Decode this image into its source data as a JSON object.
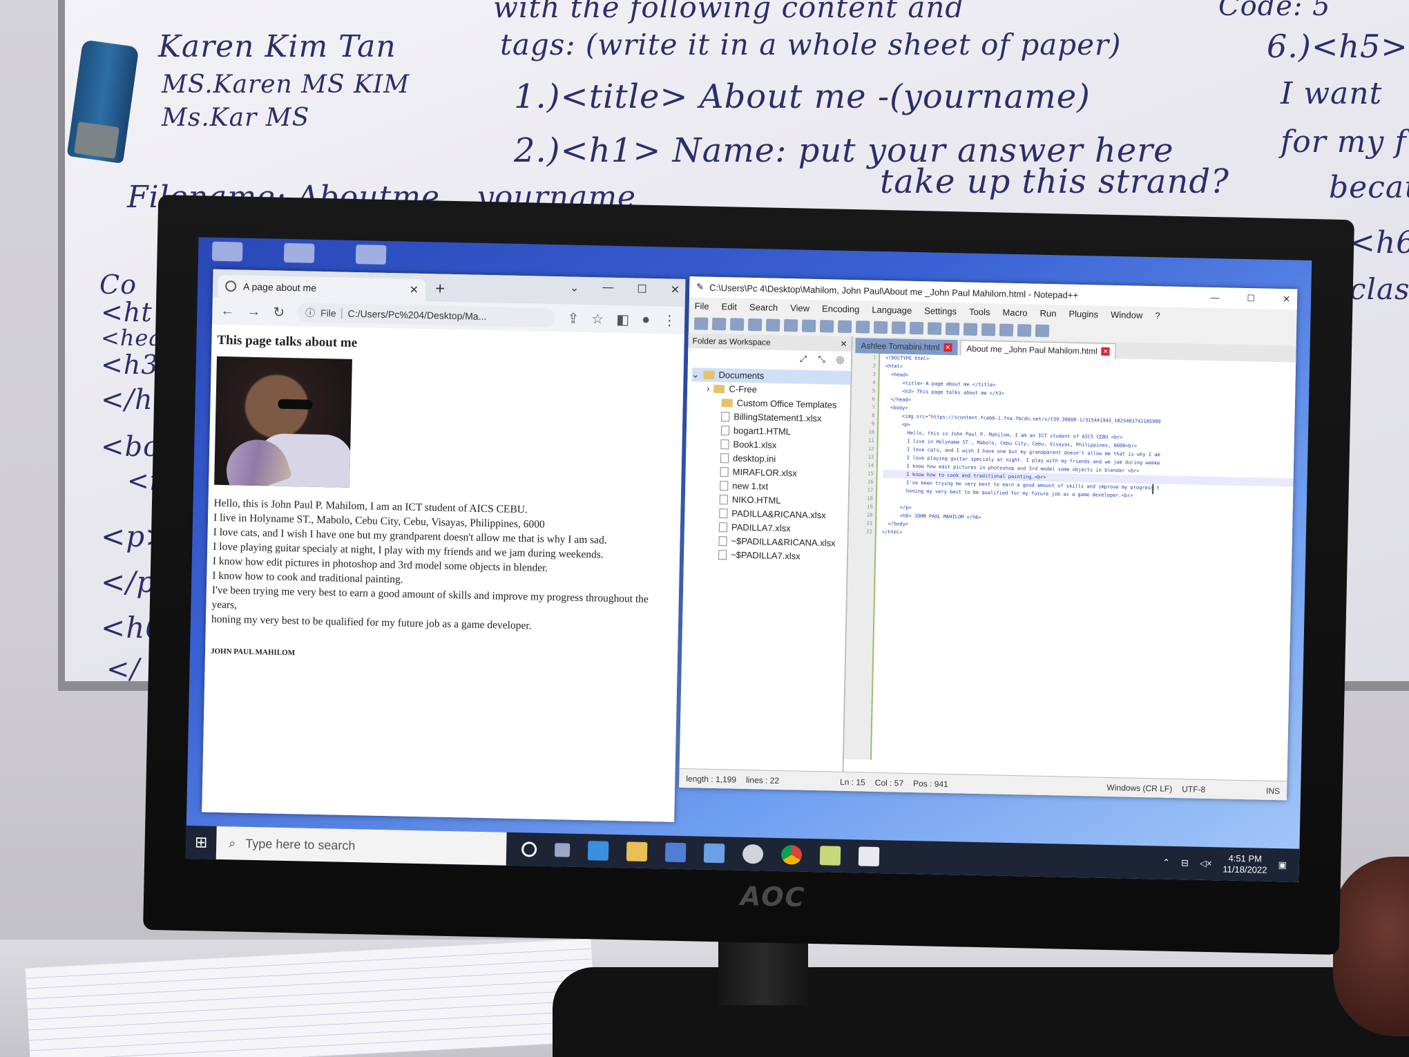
{
  "whiteboard": {
    "lines": [
      "Karen Kim Tan",
      "MS.Karen   MS KIM",
      "Ms.Kar      MS",
      "with the following content and",
      "tags: (write it in a whole sheet of paper)",
      "1.)<title> About me -(yourname)",
      "2.)<h1> Name: put your answer here",
      "Filename: Aboutme _ yourname",
      "take up this strand?",
      "6.)<h5>",
      "I want",
      "for my f",
      "becau",
      "<h6>",
      "class",
      "Code: 5"
    ],
    "left_tags": [
      "Co",
      "<ht",
      "<hea",
      "<h3",
      "</he",
      "<bod",
      "<i",
      "<p>",
      "</p",
      "<h6",
      "</"
    ]
  },
  "monitor": {
    "brand": "AOC"
  },
  "browser": {
    "tab_title": "A page about me",
    "address_chip": "File",
    "address": "C:/Users/Pc%204/Desktop/Ma...",
    "page": {
      "heading": "This page talks about me",
      "image_alt": "profile photo",
      "paragraph_lines": [
        "Hello, this is John Paul P. Mahilom, I am an ICT student of AICS CEBU.",
        "I live in Holyname ST., Mabolo, Cebu City, Cebu, Visayas, Philippines, 6000",
        "I love cats, and I wish I have one but my grandparent doesn't allow me that is why I am sad.",
        "I love playing guitar specialy at night, I play with my friends and we jam during weekends.",
        "I know how edit pictures in photoshop and 3rd model some objects in blender.",
        "I know how to cook and traditional painting.",
        "I've been trying me very best to earn a good amount of skills and improve my progress throughout the years,",
        "honing my very best to be qualified for my future job as a game developer."
      ],
      "h6": "JOHN PAUL MAHILOM"
    }
  },
  "notepad": {
    "title": "C:\\Users\\Pc 4\\Desktop\\Mahilom, John Paul\\About me _John Paul Mahilom.html - Notepad++",
    "menu": [
      "File",
      "Edit",
      "Search",
      "View",
      "Encoding",
      "Language",
      "Settings",
      "Tools",
      "Macro",
      "Run",
      "Plugins",
      "Window",
      "?"
    ],
    "sidebar_title": "Folder as Workspace",
    "tree": {
      "root": "Documents",
      "folders": [
        "C-Free",
        "Custom Office Templates"
      ],
      "files": [
        "BillingStatement1.xlsx",
        "bogart1.HTML",
        "Book1.xlsx",
        "desktop.ini",
        "MIRAFLOR.xlsx",
        "new 1.txt",
        "NIKO.HTML",
        "PADILLA&RICANA.xlsx",
        "PADILLA7.xlsx",
        "~$PADILLA&RICANA.xlsx",
        "~$PADILLA7.xlsx"
      ]
    },
    "tabs": [
      "Ashlee Tomabini.html",
      "About me _John Paul Mahilom.html"
    ],
    "code_lines": [
      "<!DOCTYPE html>",
      "<html>",
      "  <head>",
      "      <title> A page about me </title>",
      "      <h3> This page talks about me </h3>",
      "  </head>",
      "  <body>",
      "      <img src=\"https://scontent.fceb6-1.fna.fbcdn.net/v/t39.30808-1/315441943_1825403741185980",
      "      <p>",
      "        Hello, this is John Paul P. Mahilom, I am an ICT student of AICS CEBU <br>",
      "        I live in Holyname ST., Mabolo, Cebu City, Cebu, Visayas, Philippines, 6000<br>",
      "        I love cats, and I wish I have one but my grandparent doesn't allow me that is why I am",
      "        I love playing guitar specialy at night. I play with my friends and we jam during weeke",
      "        I know how edit pictures in photoshop and 3rd model some objects in blender <br>",
      "        I know how to cook and traditional painting.<br>",
      "        I've been trying me very best to earn a good amount of skills and improve my progress t",
      "        honing my very best to be qualified for my future job as a game developer.<br>",
      "",
      "      </p>",
      "      <h6> JOHN PAUL MAHILOM </h6>",
      "  </body>",
      "</html>"
    ],
    "status": {
      "length": "length : 1,199",
      "lines": "lines : 22",
      "ln": "Ln : 15",
      "col": "Col : 57",
      "pos": "Pos : 941",
      "eol": "Windows (CR LF)",
      "encoding": "UTF-8",
      "mode": "INS"
    }
  },
  "taskbar": {
    "search_placeholder": "Type here to search",
    "time": "4:51 PM",
    "date": "11/18/2022"
  }
}
